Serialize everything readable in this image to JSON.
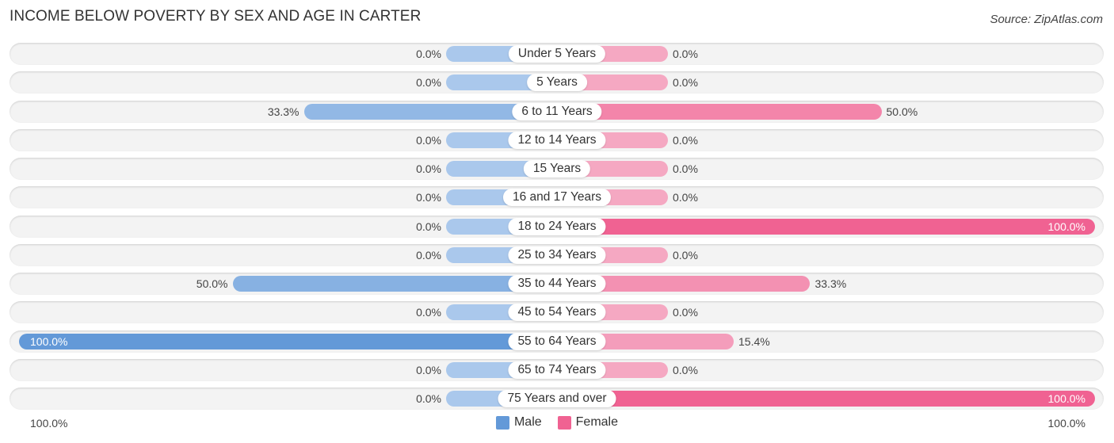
{
  "header": {
    "title": "INCOME BELOW POVERTY BY SEX AND AGE IN CARTER",
    "source": "Source: ZipAtlas.com"
  },
  "colors": {
    "male": "#6399d8",
    "male_light": "#aac8ec",
    "female": "#f06292",
    "female_light": "#f5a8c2"
  },
  "chart_data": {
    "type": "bar",
    "orientation": "horizontal-diverging",
    "title": "INCOME BELOW POVERTY BY SEX AND AGE IN CARTER",
    "categories": [
      "Under 5 Years",
      "5 Years",
      "6 to 11 Years",
      "12 to 14 Years",
      "15 Years",
      "16 and 17 Years",
      "18 to 24 Years",
      "25 to 34 Years",
      "35 to 44 Years",
      "45 to 54 Years",
      "55 to 64 Years",
      "65 to 74 Years",
      "75 Years and over"
    ],
    "series": [
      {
        "name": "Male",
        "values": [
          0.0,
          0.0,
          33.3,
          0.0,
          0.0,
          0.0,
          0.0,
          0.0,
          50.0,
          0.0,
          100.0,
          0.0,
          0.0
        ],
        "labels": [
          "0.0%",
          "0.0%",
          "33.3%",
          "0.0%",
          "0.0%",
          "0.0%",
          "0.0%",
          "0.0%",
          "50.0%",
          "0.0%",
          "100.0%",
          "0.0%",
          "0.0%"
        ]
      },
      {
        "name": "Female",
        "values": [
          0.0,
          0.0,
          50.0,
          0.0,
          0.0,
          0.0,
          100.0,
          0.0,
          33.3,
          0.0,
          15.4,
          0.0,
          100.0
        ],
        "labels": [
          "0.0%",
          "0.0%",
          "50.0%",
          "0.0%",
          "0.0%",
          "0.0%",
          "100.0%",
          "0.0%",
          "33.3%",
          "0.0%",
          "15.4%",
          "0.0%",
          "100.0%"
        ]
      }
    ],
    "xlim": [
      0,
      100
    ],
    "axis_labels": {
      "left": "100.0%",
      "right": "100.0%"
    },
    "legend": {
      "position": "bottom-center",
      "entries": [
        "Male",
        "Female"
      ]
    }
  }
}
